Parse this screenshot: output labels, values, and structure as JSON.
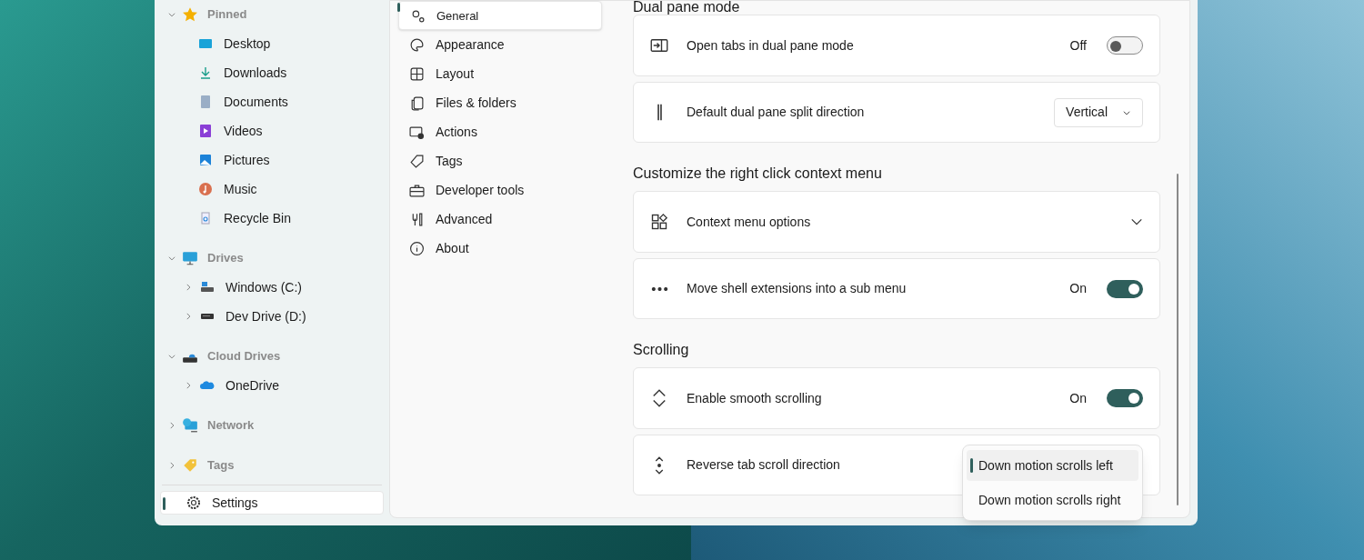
{
  "sidebar": {
    "sections": [
      {
        "label": "Pinned",
        "expanded": true,
        "children": [
          {
            "label": "Desktop"
          },
          {
            "label": "Downloads"
          },
          {
            "label": "Documents"
          },
          {
            "label": "Videos"
          },
          {
            "label": "Pictures"
          },
          {
            "label": "Music"
          },
          {
            "label": "Recycle Bin"
          }
        ]
      },
      {
        "label": "Drives",
        "expanded": true,
        "children": [
          {
            "label": "Windows (C:)",
            "expanded": false
          },
          {
            "label": "Dev Drive (D:)",
            "expanded": false
          }
        ]
      },
      {
        "label": "Cloud Drives",
        "expanded": true,
        "children": [
          {
            "label": "OneDrive",
            "expanded": false
          }
        ]
      },
      {
        "label": "Network",
        "expanded": false
      },
      {
        "label": "Tags",
        "expanded": false
      }
    ],
    "footer": {
      "label": "Settings",
      "selected": true
    }
  },
  "settings_nav": [
    {
      "label": "General",
      "selected": true
    },
    {
      "label": "Appearance",
      "selected": false
    },
    {
      "label": "Layout",
      "selected": false
    },
    {
      "label": "Files & folders",
      "selected": false
    },
    {
      "label": "Actions",
      "selected": false
    },
    {
      "label": "Tags",
      "selected": false
    },
    {
      "label": "Developer tools",
      "selected": false
    },
    {
      "label": "Advanced",
      "selected": false
    },
    {
      "label": "About",
      "selected": false
    }
  ],
  "content": [
    {
      "title": "Dual pane mode",
      "settings": [
        {
          "kind": "toggle",
          "label": "Open tabs in dual pane mode",
          "on": false,
          "state_label": "Off"
        },
        {
          "kind": "dropdown",
          "label": "Default dual pane split direction",
          "value": "Vertical"
        }
      ]
    },
    {
      "title": "Customize the right click context menu",
      "settings": [
        {
          "kind": "expander",
          "label": "Context menu options",
          "expanded": false
        },
        {
          "kind": "toggle",
          "label": "Move shell extensions into a sub menu",
          "on": true,
          "state_label": "On"
        }
      ]
    },
    {
      "title": "Scrolling",
      "settings": [
        {
          "kind": "toggle",
          "label": "Enable smooth scrolling",
          "on": true,
          "state_label": "On"
        },
        {
          "kind": "menu",
          "label": "Reverse tab scroll direction",
          "options": [
            {
              "label": "Down motion scrolls left",
              "selected": true
            },
            {
              "label": "Down motion scrolls right",
              "selected": false
            }
          ]
        }
      ]
    }
  ]
}
